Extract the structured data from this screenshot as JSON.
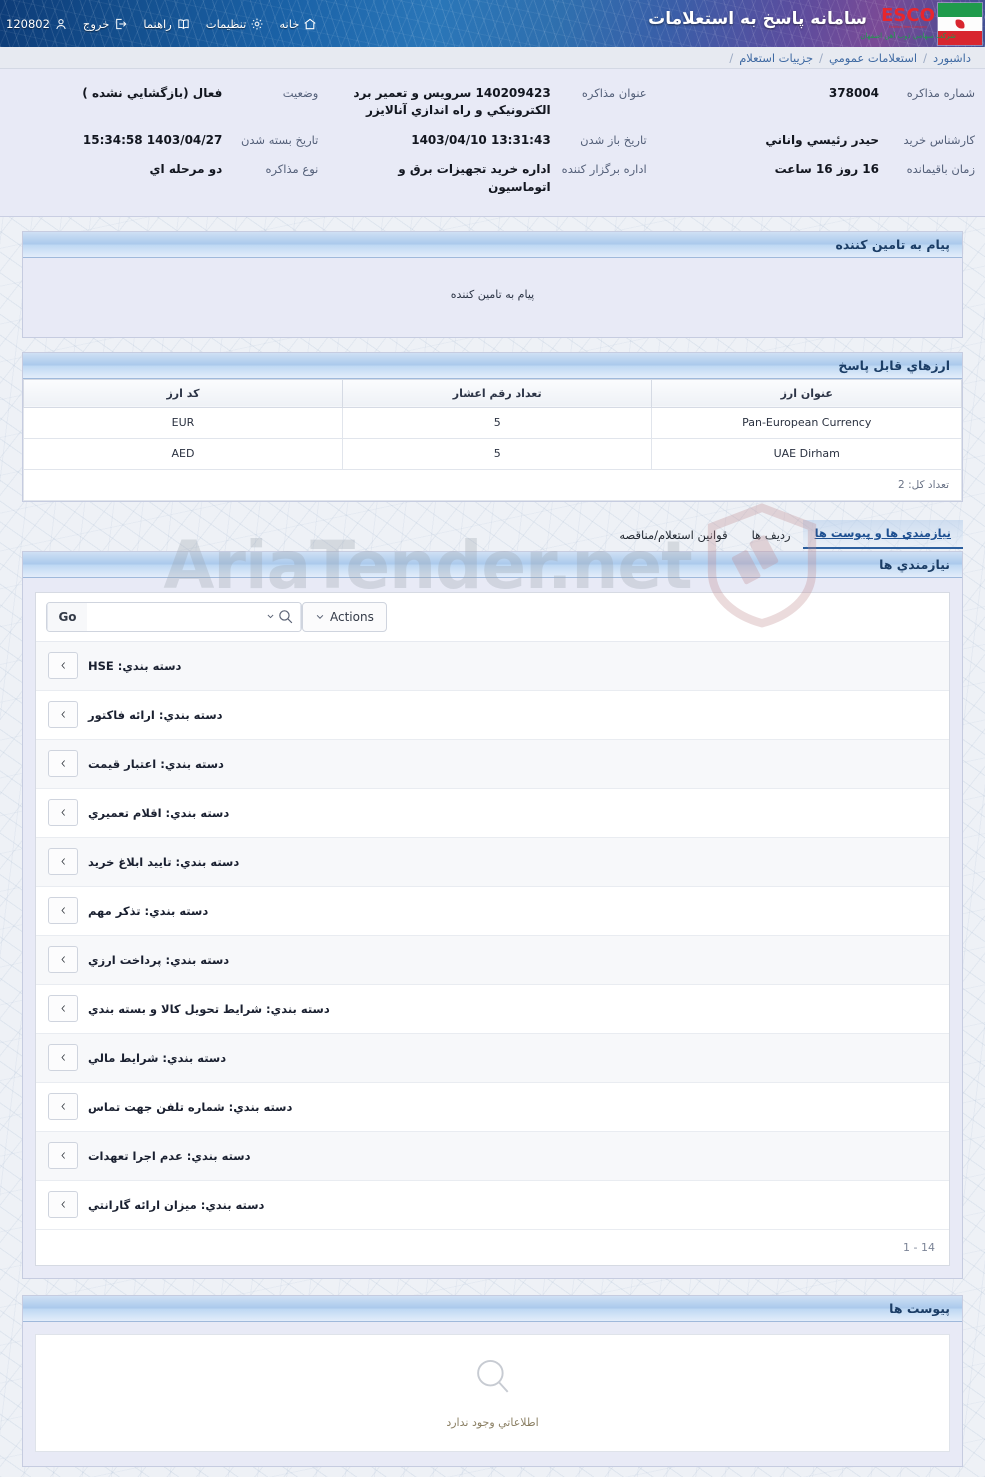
{
  "header": {
    "title": "سامانه پاسخ به استعلامات",
    "logo": {
      "brand": "ESCO",
      "brand_sub_en": "Esfahan Steel Company",
      "brand_sub_fa": "شرکت سهامي ذوب آهن اصفهان"
    },
    "nav": [
      {
        "label": "خانه",
        "icon": "home-icon"
      },
      {
        "label": "تنظیمات",
        "icon": "gear-icon"
      },
      {
        "label": "راهنما",
        "icon": "book-icon"
      },
      {
        "label": "خروج",
        "icon": "logout-icon"
      },
      {
        "label": "120802",
        "icon": "user-icon"
      }
    ]
  },
  "breadcrumb": [
    "داشبورد",
    "استعلامات عمومي",
    "جزییات استعلام"
  ],
  "info": [
    {
      "label": "شماره مذاکره",
      "value": "378004"
    },
    {
      "label": "عنوان مذاکره",
      "value": "140209423 سرويس و تعمير برد الکترونيکي و راه اندازي آنالايزر"
    },
    {
      "label": "وضعیت",
      "value": "فعال (بازگشايي نشده )"
    },
    {
      "label": "کارشناس خرید",
      "value": "حيدر رئيسي واناني"
    },
    {
      "label": "تاریخ باز شدن",
      "value": "13:31:43 1403/04/10"
    },
    {
      "label": "تاریخ بسته شدن",
      "value": "1403/04/27 15:34:58"
    },
    {
      "label": "زمان باقیمانده",
      "value": "16 روز 16 ساعت"
    },
    {
      "label": "اداره برگزار کننده",
      "value": "اداره خريد تجهيزات برق و اتوماسيون"
    },
    {
      "label": "نوع مذاکره",
      "value": "دو مرحله اي"
    }
  ],
  "message_panel": {
    "title": "پیام به تامین کننده",
    "body": "پیام به تامین کننده"
  },
  "currency_panel": {
    "title": "ارزهاي قابل پاسخ",
    "columns": [
      "کد ارز",
      "تعداد رقم اعشار",
      "عنوان ارز"
    ],
    "rows": [
      {
        "code": "EUR",
        "decimals": "5",
        "name": "Pan-European Currency"
      },
      {
        "code": "AED",
        "decimals": "5",
        "name": "UAE Dirham"
      }
    ],
    "total": "تعداد کل: 2"
  },
  "tabs": [
    {
      "label": "نیازمندي ها و پیوست ها",
      "active": true
    },
    {
      "label": "ردیف ها",
      "active": false
    },
    {
      "label": "قوانین استعلام/مناقصه",
      "active": false
    }
  ],
  "requirements_panel": {
    "title": "نیازمندي ها",
    "toolbar": {
      "search_value": "",
      "search_placeholder": "",
      "go_label": "Go",
      "actions_label": "Actions"
    },
    "rows": [
      {
        "text": "دسته بندي: HSE"
      },
      {
        "text": "دسته بندي: ارائه فاکتور"
      },
      {
        "text": "دسته بندي: اعتبار قیمت"
      },
      {
        "text": "دسته بندي: اقلام تعميري"
      },
      {
        "text": "دسته بندي: تاييد ابلاغ خرید"
      },
      {
        "text": "دسته بندي: تذکر مهم"
      },
      {
        "text": "دسته بندي: پرداخت ارزي"
      },
      {
        "text": "دسته بندي: شرايط تحويل کالا و بسته بندي"
      },
      {
        "text": "دسته بندي: شرايط مالي"
      },
      {
        "text": "دسته بندي: شماره تلفن جهت تماس"
      },
      {
        "text": "دسته بندي: عدم اجرا تعهدات"
      },
      {
        "text": "دسته بندي: میزان ارائه گارانتي"
      }
    ],
    "pager": "1 - 14"
  },
  "attachments_panel": {
    "title": "پیوست ها",
    "empty_text": "اطلاعاتي وجود ندارد"
  },
  "watermark": {
    "text": "AriaTender.net"
  },
  "colors": {
    "header_blue": "#1b63a8",
    "panel_head": "#aac9ec",
    "accent": "#2c5f9e",
    "info_bg": "#e8eaf6",
    "brand_red": "#e8262d",
    "brand_green": "#1f9b4c"
  }
}
